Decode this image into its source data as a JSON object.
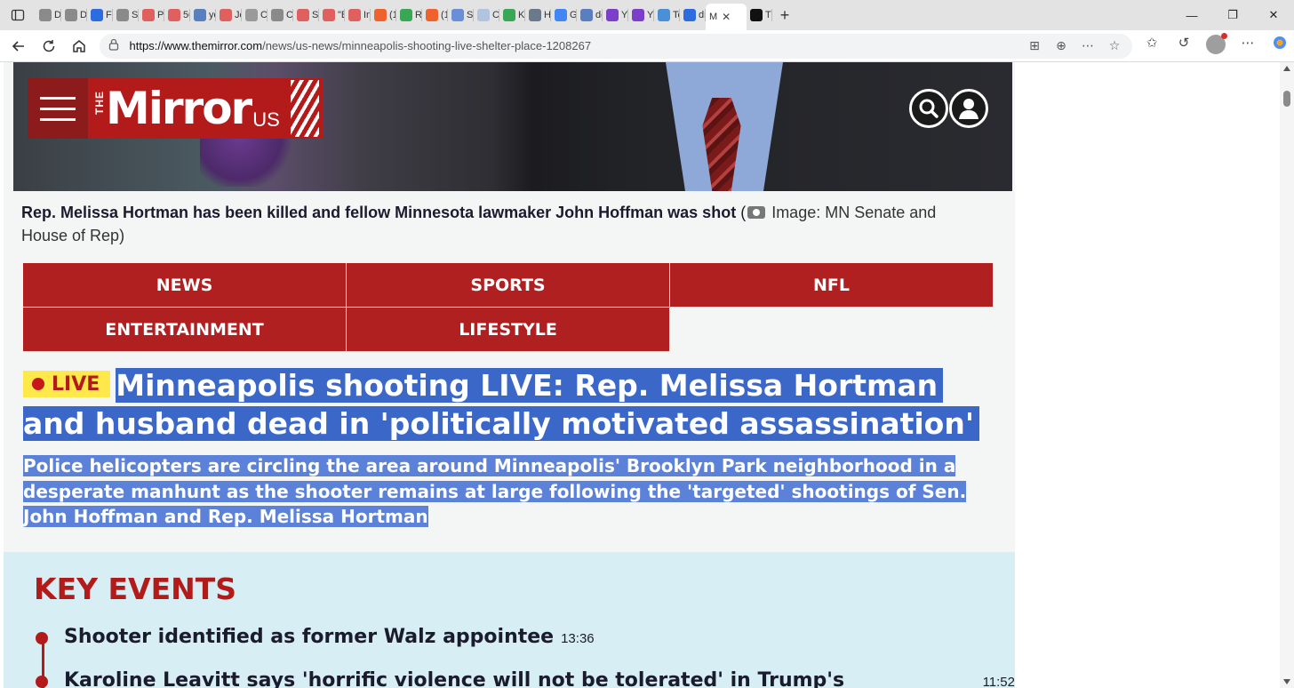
{
  "browser": {
    "tabs": [
      {
        "label": "Dr",
        "color": "#8a8a8a"
      },
      {
        "label": "Dr",
        "color": "#8a8a8a"
      },
      {
        "label": "Fo",
        "color": "#2d6cdf"
      },
      {
        "label": "Sh",
        "color": "#8a8a8a"
      },
      {
        "label": "Pe",
        "color": "#e06060"
      },
      {
        "label": "50",
        "color": "#e06060"
      },
      {
        "label": "yo",
        "color": "#5a7fc0"
      },
      {
        "label": "Je",
        "color": "#e06060"
      },
      {
        "label": "Cc",
        "color": "#9a9a9a"
      },
      {
        "label": "Cc",
        "color": "#8a8a8a"
      },
      {
        "label": "Sil",
        "color": "#e06060"
      },
      {
        "label": "\"B",
        "color": "#e06060"
      },
      {
        "label": "In",
        "color": "#e06060"
      },
      {
        "label": "(1",
        "color": "#f0622d"
      },
      {
        "label": "Re",
        "color": "#3aa757"
      },
      {
        "label": "(1",
        "color": "#f0622d"
      },
      {
        "label": "Sh",
        "color": "#6b8fd6"
      },
      {
        "label": "Cc",
        "color": "#b0c4e0"
      },
      {
        "label": "Ki",
        "color": "#3aa757"
      },
      {
        "label": "Ha",
        "color": "#6b7a8a"
      },
      {
        "label": "Gi",
        "color": "#4285f4"
      },
      {
        "label": "dc",
        "color": "#5a7fc0"
      },
      {
        "label": "Ya",
        "color": "#7b3fc9"
      },
      {
        "label": "Ya",
        "color": "#7b3fc9"
      },
      {
        "label": "Te",
        "color": "#4a90d9"
      },
      {
        "label": "dr",
        "color": "#2d6cdf"
      }
    ],
    "active_tab": {
      "label": "M",
      "close": "✕"
    },
    "after_active_tab": {
      "label": "Tri",
      "color": "#111111"
    },
    "new_tab": "+",
    "window_controls": {
      "minimize": "—",
      "restore": "❐",
      "close": "✕"
    },
    "url_host": "https://www.themirror.com",
    "url_path": "/news/us-news/minneapolis-shooting-live-shelter-place-1208267"
  },
  "site": {
    "logo_the": "THE",
    "logo_name": "Mirror",
    "logo_region": "US",
    "accent_color": "#b31b1b"
  },
  "article": {
    "caption_bold": "Rep. Melissa Hortman has been killed and fellow Minnesota lawmaker John Hoffman was shot",
    "caption_credit_open": " (",
    "caption_credit": " Image: MN Senate and House of Rep)",
    "nav": [
      "NEWS",
      "SPORTS",
      "NFL",
      "ENTERTAINMENT",
      "LIFESTYLE"
    ],
    "live_label": "LIVE",
    "headline": "Minneapolis shooting LIVE: Rep. Melissa Hortman and husband dead in 'politically motivated assassination'",
    "standfirst": "Police helicopters are circling the area around Minneapolis' Brooklyn Park neighborhood in a desperate manhunt as the shooter remains at large following the 'targeted' shootings of Sen. John Hoffman and Rep. Melissa Hortman",
    "key_events_title": "KEY EVENTS",
    "events": [
      {
        "title": "Shooter identified as former Walz appointee",
        "time": "13:36"
      },
      {
        "title": "Karoline Leavitt says 'horrific violence will not be tolerated' in Trump's 'statement'",
        "time": "11:52"
      }
    ]
  }
}
